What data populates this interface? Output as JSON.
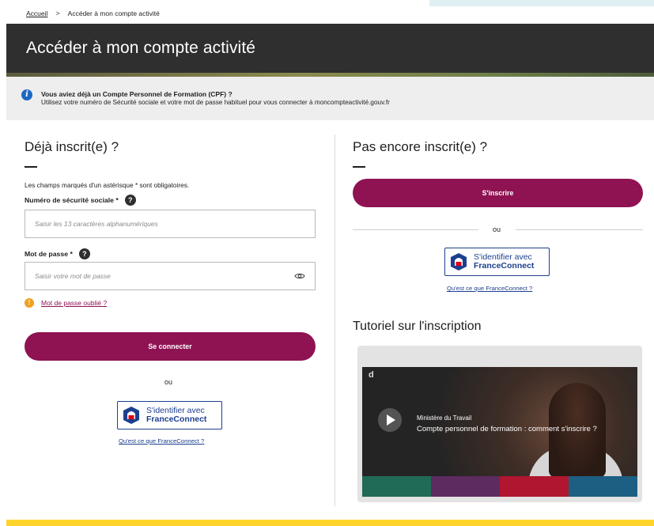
{
  "breadcrumb": {
    "home": "Accueil",
    "separator": ">",
    "current": "Accéder à mon compte activité"
  },
  "page": {
    "title": "Accéder à mon compte activité"
  },
  "info": {
    "icon": "info-icon",
    "title": "Vous aviez déjà un Compte Personnel de Formation (CPF) ?",
    "text": "Utilisez votre numéro de Sécurité sociale et votre mot de passe habituel pour vous connecter à moncompteactivité.gouv.fr"
  },
  "login": {
    "title": "Déjà inscrit(e) ?",
    "required_note": "Les champs marqués d'un astérisque * sont obligatoires.",
    "ssn_label": "Numéro de sécurité sociale *",
    "ssn_placeholder": "Saisir les 13 caractères alphanumériques",
    "ssn_value": "",
    "password_label": "Mot de passe *",
    "password_placeholder": "Saisir votre mot de passe",
    "password_value": "",
    "forgot_link": "Mot de passe oublié ?",
    "submit": "Se connecter",
    "or": "ou",
    "fc_line1": "S'identifier avec",
    "fc_line2": "FranceConnect",
    "fc_link": "Qu'est ce que FranceConnect ?"
  },
  "signup": {
    "title": "Pas encore inscrit(e) ?",
    "submit": "S'inscrire",
    "or": "ou",
    "fc_line1": "S'identifier avec",
    "fc_line2": "FranceConnect",
    "fc_link": "Qu'est ce que FranceConnect ?"
  },
  "tutorial": {
    "title": "Tutoriel sur l'inscription",
    "video_brand": "d",
    "video_channel": "Ministère du Travail",
    "video_title": "Compte personnel de formation : comment s'inscrire ?"
  },
  "colors": {
    "accent": "#8f1253",
    "header_bg": "#2f2f2f",
    "info_bg": "#eeeeee",
    "footer_bar": "#ffd42a",
    "franceconnect_blue": "#1c3f8f"
  }
}
